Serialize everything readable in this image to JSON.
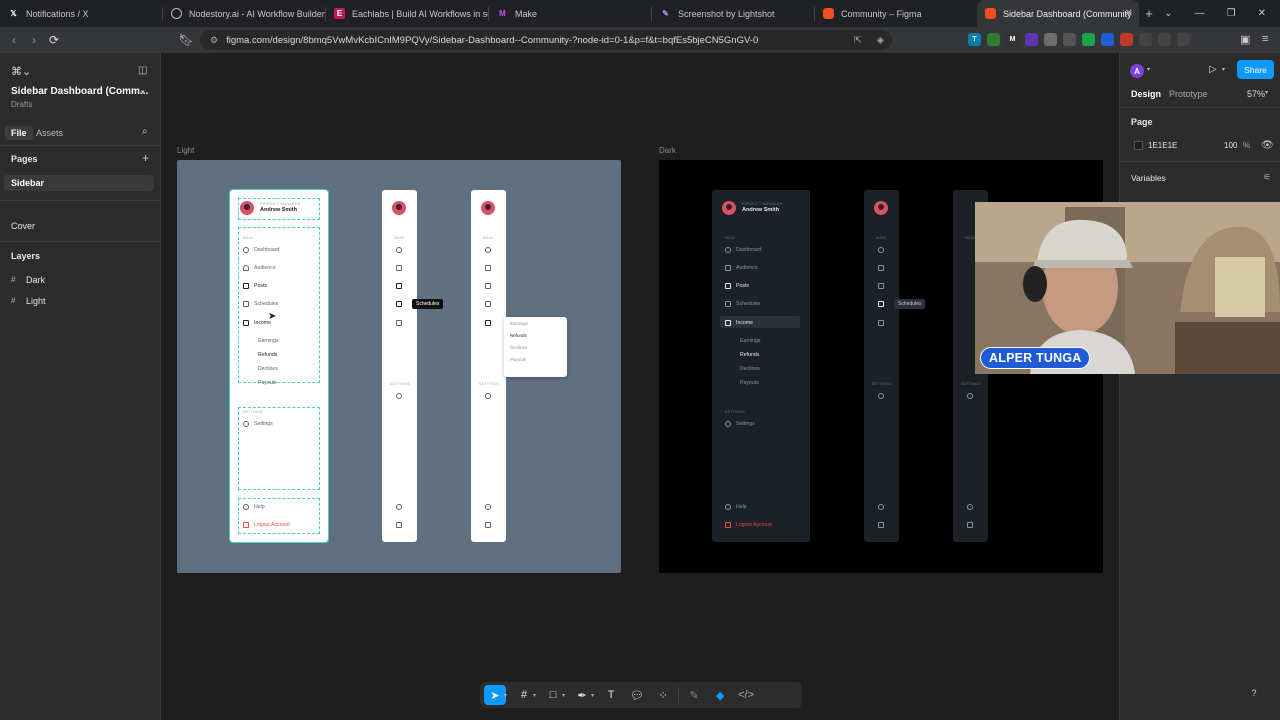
{
  "browser": {
    "tabs": [
      {
        "title": "Notifications / X",
        "icon": "x-logo-icon",
        "active": false
      },
      {
        "title": "Nodestory.ai - AI Workflow Builder",
        "icon": "globe-icon",
        "active": false
      },
      {
        "title": "Eachlabs | Build AI Workflows in sec",
        "icon": "eachlabs-icon",
        "active": false
      },
      {
        "title": "Make",
        "icon": "make-icon",
        "active": false
      },
      {
        "title": "Screenshot by Lightshot",
        "icon": "feather-icon",
        "active": false
      },
      {
        "title": "Community – Figma",
        "icon": "figma-icon",
        "active": false
      },
      {
        "title": "Sidebar Dashboard (Community",
        "icon": "figma-icon",
        "active": true
      }
    ],
    "new_tab": "+",
    "url": "figma.com/design/8bmq5VwMvKcbICnIM9PQVy/Sidebar-Dashboard--Community-?node-id=0-1&p=f&t=bqfEs5bjeCN5GnGV-0",
    "extensions": [
      "T",
      "●",
      "M",
      "●",
      "●",
      "●",
      "●",
      "●",
      "●",
      "●",
      "●",
      "●"
    ]
  },
  "left_panel": {
    "file_name": "Sidebar Dashboard (Comm...",
    "location": "Drafts",
    "tabs": [
      "File",
      "Assets"
    ],
    "pages_title": "Pages",
    "pages": [
      "Sidebar",
      "Cover"
    ],
    "layers_title": "Layers",
    "layers": [
      "Dark",
      "Light"
    ]
  },
  "right_panel": {
    "avatar_letter": "A",
    "share_label": "Share",
    "tabs": [
      "Design",
      "Prototype"
    ],
    "zoom": "57%",
    "page_title": "Page",
    "page_color": "1E1E1E",
    "page_opacity": "100",
    "percent_sign": "%",
    "variables_title": "Variables"
  },
  "canvas": {
    "light_label": "Light",
    "dark_label": "Dark",
    "profile_role": "PRODUCT MANAGER",
    "profile_name": "Andrew Smith",
    "main_label": "MAIN",
    "settings_label": "SETTINGS",
    "nav": [
      "Dashboard",
      "Audience",
      "Posts",
      "Schedules",
      "Income"
    ],
    "income_sub": [
      "Earnings",
      "Refunds",
      "Declines",
      "Payouts"
    ],
    "settings_item": "Settings",
    "help": "Help",
    "logout": "Logout Account",
    "tooltip": "Schedules"
  },
  "webcam": {
    "name": "ALPER TUNGA"
  },
  "toolbar": {
    "tools": [
      "move-tool",
      "frame-tool",
      "shape-tool",
      "pen-tool",
      "text-tool",
      "comment-tool",
      "actions-tool",
      "draw-mode",
      "design-mode",
      "dev-mode"
    ]
  },
  "colors": {
    "accent": "#0d99ff",
    "light_frame_bg": "#5f7080",
    "dark_frame_bg": "#000000",
    "logout_red": "#e5484d",
    "selection_teal": "#4ecdc4",
    "name_badge": "#1f5bd8"
  }
}
